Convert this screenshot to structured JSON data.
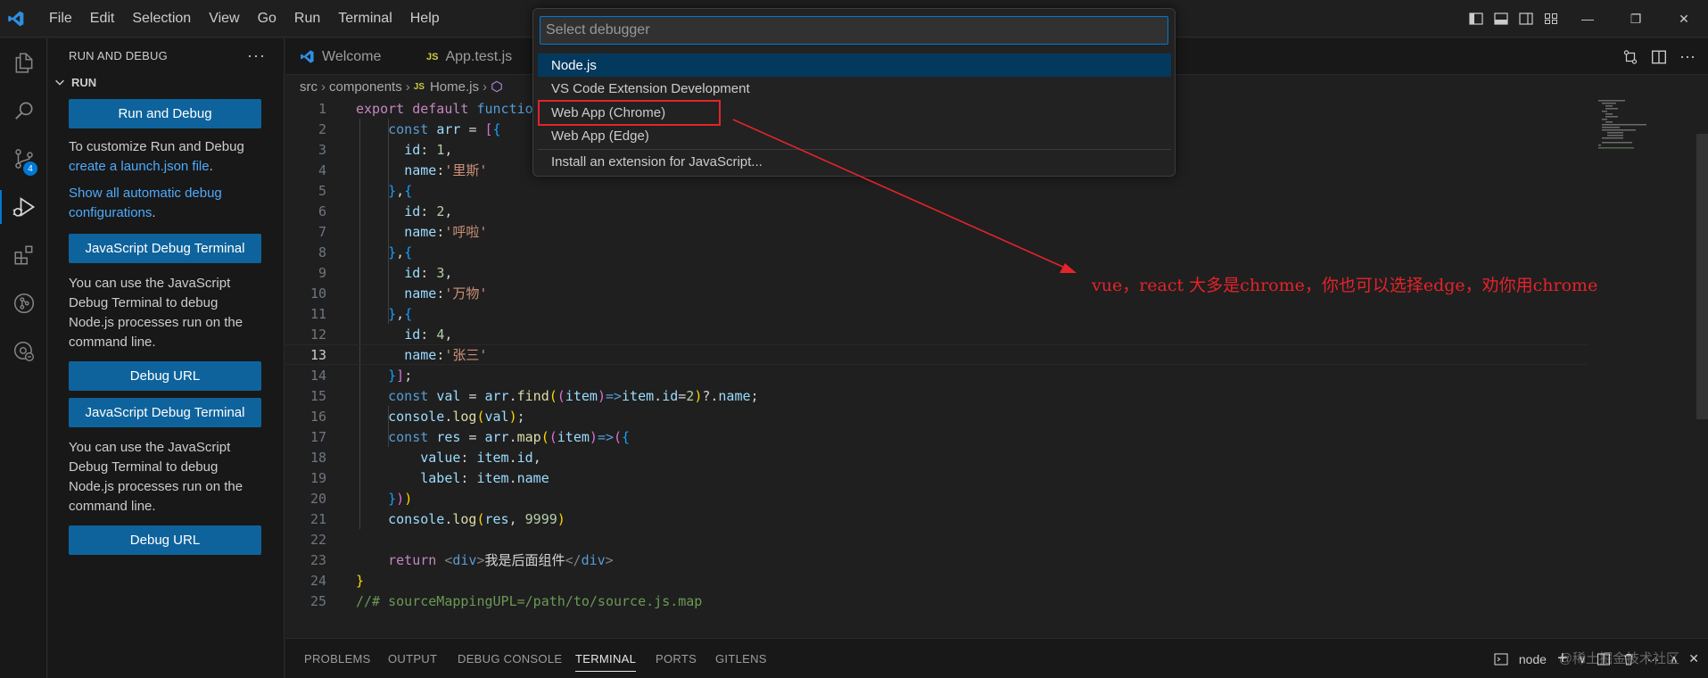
{
  "menu": [
    "File",
    "Edit",
    "Selection",
    "View",
    "Go",
    "Run",
    "Terminal",
    "Help"
  ],
  "window_controls": {
    "minimize": "—",
    "restore": "❐",
    "close": "✕"
  },
  "activity": {
    "source_control_badge": "4"
  },
  "sidebar": {
    "title": "RUN AND DEBUG",
    "more": "···",
    "section": "RUN",
    "run_button": "Run and Debug",
    "customize_text": "To customize Run and Debug",
    "create_link": "create a launch.json file",
    "period": ".",
    "show_link": "Show all automatic debug configurations",
    "buttons": {
      "js_terminal_1": "JavaScript Debug Terminal",
      "debug_url_1": "Debug URL",
      "js_terminal_2": "JavaScript Debug Terminal",
      "debug_url_2": "Debug URL"
    },
    "terminal_text": "You can use the JavaScript Debug Terminal to debug Node.js processes run on the command line."
  },
  "tabs": [
    {
      "label": "Welcome"
    },
    {
      "label": "App.test.js",
      "badge": "JS"
    }
  ],
  "breadcrumb": {
    "parts": [
      "src",
      "components",
      "Home.js"
    ],
    "badge": "JS"
  },
  "editor": {
    "line_numbers": [
      "1",
      "2",
      "3",
      "4",
      "5",
      "6",
      "7",
      "8",
      "9",
      "10",
      "11",
      "12",
      "13",
      "14",
      "15",
      "16",
      "17",
      "18",
      "19",
      "20",
      "21",
      "22",
      "23",
      "24",
      "25"
    ],
    "current_line": "13",
    "strings": {
      "l1_kw": "export default",
      "l1_fn": "functio",
      "l4_str": "'里斯'",
      "l7_str": "'呼啦'",
      "l10_str": "'万物'",
      "l13_str": "'张三'",
      "l23_jsx": "我是后面组件",
      "l25_cmt": "//# sourceMappingUPL=/path/to/source.js.map"
    }
  },
  "quickpick": {
    "placeholder": "Select debugger",
    "items": [
      {
        "label": "Node.js",
        "selected": true
      },
      {
        "label": "VS Code Extension Development"
      },
      {
        "label": "Web App (Chrome)"
      },
      {
        "label": "Web App (Edge)"
      },
      {
        "label": "Install an extension for JavaScript..."
      }
    ]
  },
  "annotation": {
    "text": "vue，react 大多是chrome，你也可以选择edge，劝你用chrome",
    "color": "#e4232a"
  },
  "panel": {
    "tabs": [
      "PROBLEMS",
      "OUTPUT",
      "DEBUG CONSOLE",
      "TERMINAL",
      "PORTS",
      "GITLENS"
    ],
    "active_tab": "TERMINAL",
    "terminal_name": "node",
    "watermark": "@稀土掘金技术社区"
  },
  "colors": {
    "accent": "#0078d4",
    "button": "#0e639c",
    "link": "#4daafc",
    "selected_item": "#04395e"
  }
}
